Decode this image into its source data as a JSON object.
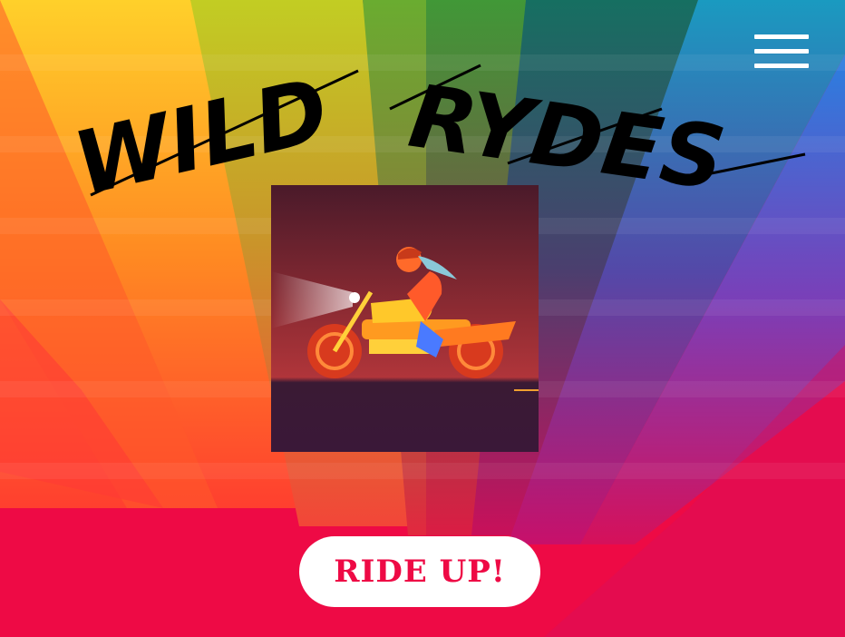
{
  "brand": {
    "logo_text": "WILD RYDES",
    "logo_words": [
      "WILD",
      "RYDES"
    ]
  },
  "header": {
    "menu_icon": "hamburger-menu-icon"
  },
  "hero": {
    "image_subject": "rider-on-motorcycle-illustration"
  },
  "cta": {
    "label": "RIDE UP!"
  },
  "colors": {
    "background_base": "#ee0a45",
    "cta_text": "#ee0a45",
    "cta_background": "#ffffff",
    "menu_icon": "#ffffff",
    "logo": "#000000",
    "rays": [
      "#ff7a22",
      "#c2cd23",
      "#63a932",
      "#2f8f3a",
      "#166f61",
      "#1a8eb6",
      "#5a4fc4"
    ]
  }
}
